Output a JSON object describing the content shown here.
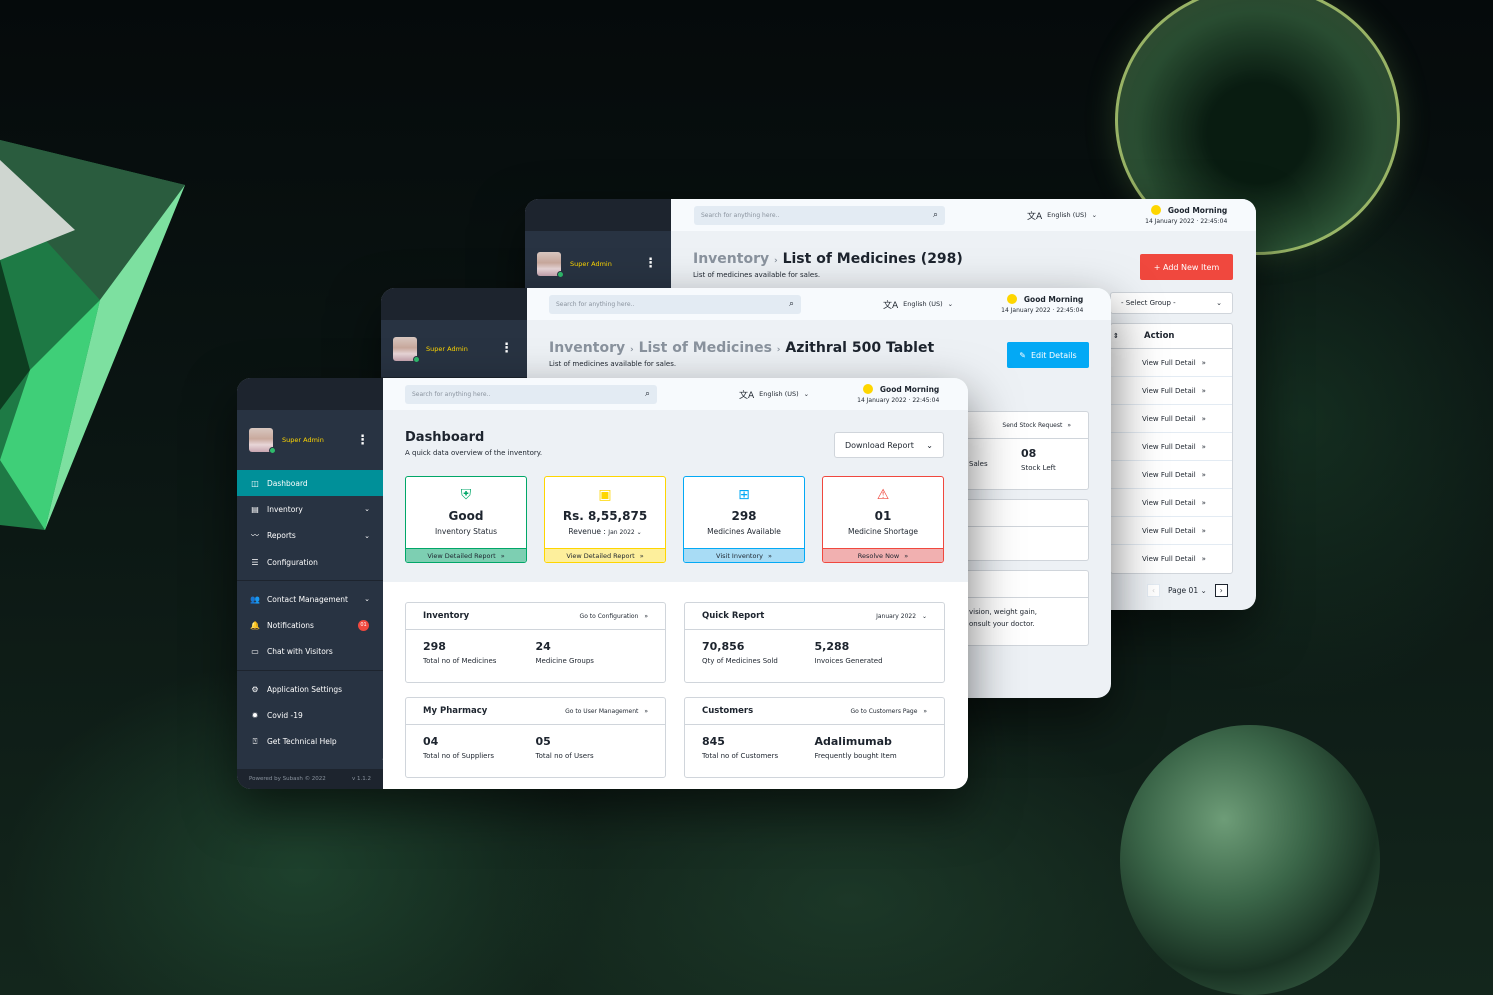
{
  "common": {
    "role": "Super Admin",
    "search_placeholder": "Search for anything here..",
    "language": "English (US)",
    "greeting": "Good Morning",
    "date": "14 January 2022",
    "time": "22:45:04",
    "icons": {
      "search": "🔍",
      "translate": "文A",
      "chevron_down": "⌄",
      "double_chevron": "»",
      "kebab": "⋮"
    }
  },
  "window_back": {
    "breadcrumb_parent": "Inventory",
    "breadcrumb_current": "List of Medicines (298)",
    "subtitle": "List of medicines available for sales.",
    "add_button": "+ Add New Item",
    "select_group": "- Select Group -",
    "table_action_header": "Action",
    "rows": [
      "View Full Detail",
      "View Full Detail",
      "View Full Detail",
      "View Full Detail",
      "View Full Detail",
      "View Full Detail",
      "View Full Detail",
      "View Full Detail"
    ],
    "pagination": {
      "page_label": "Page 01",
      "prev": "‹",
      "next": "›"
    }
  },
  "window_mid": {
    "breadcrumb_1": "Inventory",
    "breadcrumb_2": "List of Medicines",
    "breadcrumb_current": "Azithral 500 Tablet",
    "subtitle": "List of medicines available for sales.",
    "edit_button": "Edit Details",
    "send_stock_link": "Send Stock Request",
    "stock_left_value": "08",
    "stock_left_label": "Stock Left",
    "sales_label_partial": "Sales",
    "side_effects_partial_1": "vision, weight gain,",
    "side_effects_partial_2": "onsult your doctor."
  },
  "window_front": {
    "sidebar": {
      "items": [
        {
          "label": "Dashboard",
          "icon": "dashboard-icon",
          "glyph": "◫",
          "active": true
        },
        {
          "label": "Inventory",
          "icon": "inventory-icon",
          "glyph": "▤",
          "chevron": true
        },
        {
          "label": "Reports",
          "icon": "reports-icon",
          "glyph": "〰",
          "chevron": true
        },
        {
          "label": "Configuration",
          "icon": "configuration-icon",
          "glyph": "☰"
        }
      ],
      "items2": [
        {
          "label": "Contact Management",
          "icon": "contacts-icon",
          "glyph": "👥",
          "chevron": true
        },
        {
          "label": "Notifications",
          "icon": "bell-icon",
          "glyph": "🔔",
          "badge": "01"
        },
        {
          "label": "Chat with Visitors",
          "icon": "chat-icon",
          "glyph": "▭"
        }
      ],
      "items3": [
        {
          "label": "Application Settings",
          "icon": "settings-icon",
          "glyph": "⚙"
        },
        {
          "label": "Covid -19",
          "icon": "covid-icon",
          "glyph": "✹"
        },
        {
          "label": "Get Technical Help",
          "icon": "help-icon",
          "glyph": "⍰"
        }
      ],
      "footer": "Powered by Subash © 2022",
      "version": "v 1.1.2"
    },
    "title": "Dashboard",
    "subtitle": "A quick data overview of the inventory.",
    "download_button": "Download Report",
    "cards": [
      {
        "value": "Good",
        "label": "Inventory Status",
        "link": "View Detailed Report",
        "color": "#01a768",
        "footer_bg": "#7dcfb2",
        "glyph": "⛨"
      },
      {
        "value": "Rs. 8,55,875",
        "label": "Revenue :",
        "period": "Jan 2022",
        "link": "View Detailed Report",
        "color": "#fed600",
        "footer_bg": "#fdef9c",
        "glyph": "▣"
      },
      {
        "value": "298",
        "label": "Medicines Available",
        "link": "Visit Inventory",
        "color": "#03a9f5",
        "footer_bg": "#a8dcf5",
        "glyph": "⊞"
      },
      {
        "value": "01",
        "label": "Medicine Shortage",
        "link": "Resolve Now",
        "color": "#f0483e",
        "footer_bg": "#f1b0b0",
        "glyph": "⚠"
      }
    ],
    "panels": [
      {
        "title": "Inventory",
        "link": "Go to Configuration",
        "stats": [
          {
            "value": "298",
            "label": "Total no of Medicines"
          },
          {
            "value": "24",
            "label": "Medicine Groups"
          }
        ]
      },
      {
        "title": "Quick Report",
        "link": "January 2022",
        "stats": [
          {
            "value": "70,856",
            "label": "Qty of Medicines Sold"
          },
          {
            "value": "5,288",
            "label": "Invoices Generated"
          }
        ]
      },
      {
        "title": "My Pharmacy",
        "link": "Go to User Management",
        "stats": [
          {
            "value": "04",
            "label": "Total no of Suppliers"
          },
          {
            "value": "05",
            "label": "Total no of Users"
          }
        ]
      },
      {
        "title": "Customers",
        "link": "Go to Customers Page",
        "stats": [
          {
            "value": "845",
            "label": "Total no of Customers"
          },
          {
            "value": "Adalimumab",
            "label": "Frequently bought Item"
          }
        ]
      }
    ]
  }
}
